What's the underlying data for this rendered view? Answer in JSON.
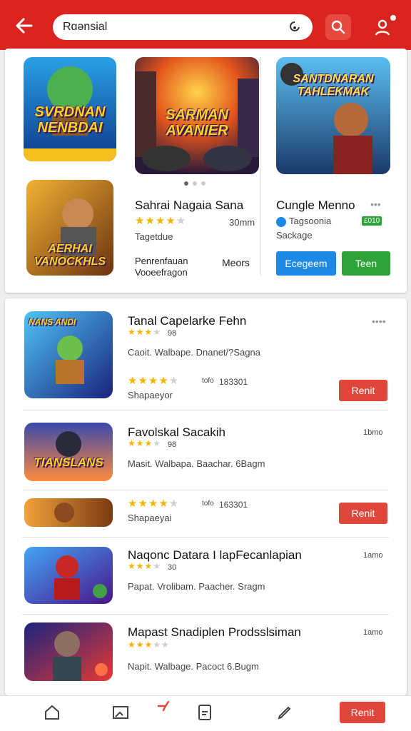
{
  "header": {
    "search_value": "Rɑənsial",
    "accent": "#d9241f"
  },
  "featured": {
    "apps": [
      {
        "art_title": "SVRDNAN NENBDAI",
        "name": "",
        "rating": 0
      },
      {
        "art_title": "SARMAN AVANIER",
        "name": "Sahrai Nagaia Sana",
        "rating": 4,
        "size": "30mm",
        "dev": "Tagetdue",
        "desc1": "Penrenfauan",
        "desc2": "Vooeefragon",
        "more": "Meors"
      },
      {
        "art_title": "SANTDNARAN TAHLEKMAK",
        "name": "Cungle Menno",
        "dev": "Tagsoonia",
        "category": "Sackage",
        "chip": "£010",
        "primary_btn": "Ecegeem",
        "secondary_btn": "Teen"
      },
      {
        "art_title": "AERHAI VANOCKHLS"
      }
    ],
    "more_dots": "•••"
  },
  "list": {
    "items": [
      {
        "art_title": "NANS ANDI",
        "name": "Tanal Capelarke Fehn",
        "rating": 3,
        "size": "98",
        "desc": "Caoit. Walbape. Dnanet/?Sagna",
        "rating2": 4,
        "count": "183301",
        "count_label": "tofo",
        "tag": "Shapaeyor",
        "button": "Renit",
        "menu": "••••"
      },
      {
        "art_title": "TIANSLANS",
        "name": "Favolskal Sacakih",
        "rating": 3,
        "size": "98",
        "desc": "Masit. Walbapa. Baachar. 6Bagm",
        "right": "1bmo"
      },
      {
        "art_title": "",
        "name": "",
        "rating": 4,
        "count": "163301",
        "count_label": "tofo",
        "tag": "Shapaeyai",
        "button": "Renit"
      },
      {
        "art_title": "",
        "name": "Naqonc Datara I lapFecanlapian",
        "rating": 3,
        "size": "30",
        "desc": "Papat. Vrolibam. Paacher. Sragm",
        "right": "1amo"
      },
      {
        "art_title": "",
        "name": "Mapast Snadiplen Prodsslsiman",
        "rating": 3,
        "desc": "Napit. Walbage. Pacoct 6.Bugm",
        "right": "1amo"
      }
    ]
  },
  "bottom_nav": {
    "items": [
      "home-icon",
      "image-icon",
      "flag-icon",
      "bookmark-icon",
      "edit-icon"
    ],
    "button": "Renit"
  }
}
